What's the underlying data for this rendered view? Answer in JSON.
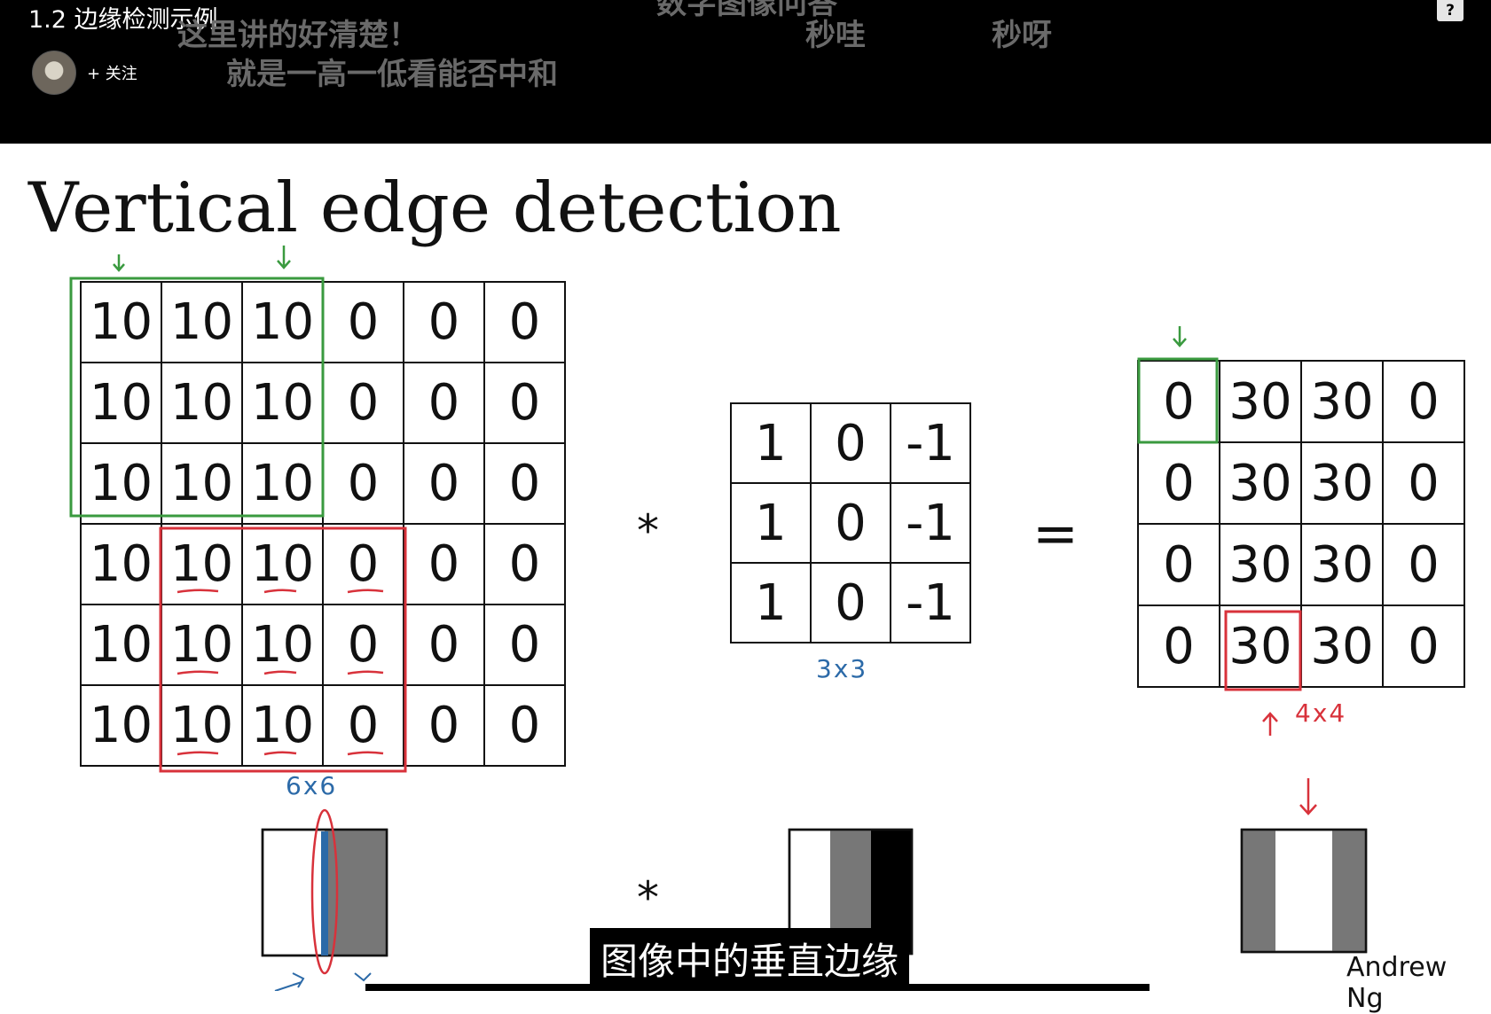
{
  "player": {
    "video_title": "1.2 边缘检测示例",
    "follow_label": "+ 关注",
    "help_icon": "?"
  },
  "danmaku": [
    "这里讲的好清楚！",
    "就是一高一低看能否中和",
    "秒哇",
    "秒呀",
    "数字图像问答"
  ],
  "slide": {
    "title": "Vertical edge detection",
    "input_matrix": [
      [
        "10",
        "10",
        "10",
        "0",
        "0",
        "0"
      ],
      [
        "10",
        "10",
        "10",
        "0",
        "0",
        "0"
      ],
      [
        "10",
        "10",
        "10",
        "0",
        "0",
        "0"
      ],
      [
        "10",
        "10",
        "10",
        "0",
        "0",
        "0"
      ],
      [
        "10",
        "10",
        "10",
        "0",
        "0",
        "0"
      ],
      [
        "10",
        "10",
        "10",
        "0",
        "0",
        "0"
      ]
    ],
    "filter_matrix": [
      [
        "1",
        "0",
        "-1"
      ],
      [
        "1",
        "0",
        "-1"
      ],
      [
        "1",
        "0",
        "-1"
      ]
    ],
    "output_matrix": [
      [
        "0",
        "30",
        "30",
        "0"
      ],
      [
        "0",
        "30",
        "30",
        "0"
      ],
      [
        "0",
        "30",
        "30",
        "0"
      ],
      [
        "0",
        "30",
        "30",
        "0"
      ]
    ],
    "conv_operator": "*",
    "equals_operator": "=",
    "input_size_note": "6x6",
    "filter_size_note": "3x3",
    "output_size_note": "4x4",
    "credit": "Andrew Ng",
    "colors": {
      "annotation_green": "#3a9a3f",
      "annotation_red": "#d8323b",
      "annotation_blue": "#2c6aa8",
      "gray_band": "#777777"
    }
  },
  "subtitle": "图像中的垂直边缘"
}
